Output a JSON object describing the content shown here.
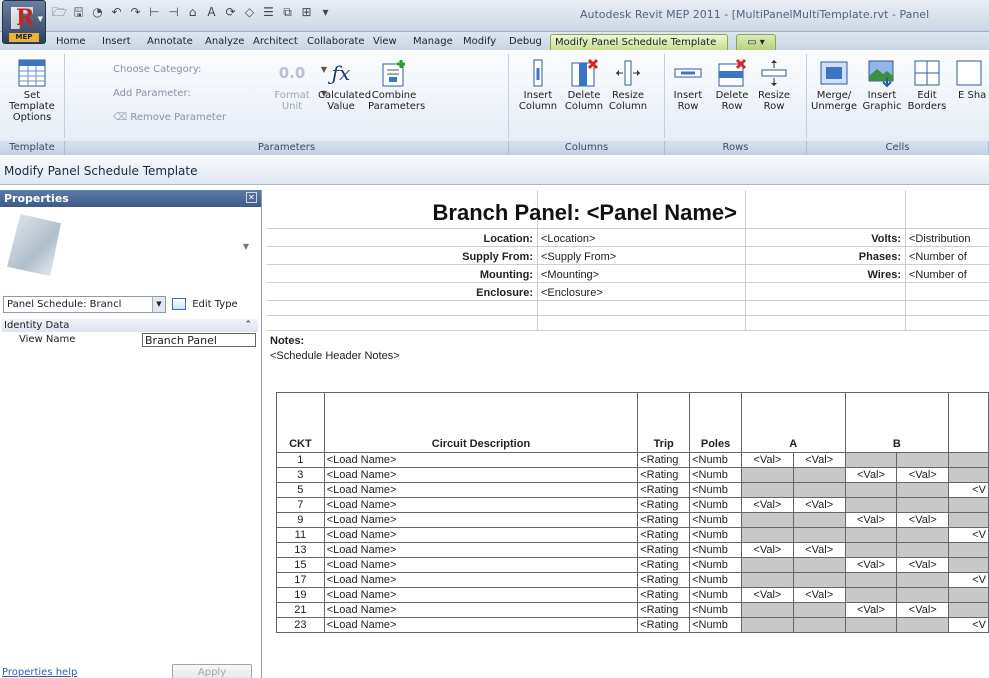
{
  "app": {
    "window_title": "Autodesk Revit MEP 2011 - [MultiPanelMultiTemplate.rvt - Panel",
    "app_button_tag": "MEP"
  },
  "tabs": [
    {
      "label": "Home"
    },
    {
      "label": "Insert"
    },
    {
      "label": "Annotate"
    },
    {
      "label": "Analyze"
    },
    {
      "label": "Architect"
    },
    {
      "label": "Collaborate"
    },
    {
      "label": "View"
    },
    {
      "label": "Manage"
    },
    {
      "label": "Modify"
    },
    {
      "label": "Debug"
    },
    {
      "label": "Modify Panel Schedule Template"
    }
  ],
  "ribbon": {
    "set_template_options": "Set Template Options",
    "choose_category": "Choose Category:",
    "add_parameter": "Add Parameter:",
    "remove_parameter": "Remove Parameter",
    "format_unit": "Format Unit",
    "calculated_value": "Calculated Value",
    "combine_parameters": "Combine Parameters",
    "insert_column": "Insert Column",
    "delete_column": "Delete Column",
    "resize_column": "Resize Column",
    "insert_row": "Insert Row",
    "delete_row": "Delete Row",
    "resize_row": "Resize Row",
    "merge_unmerge": "Merge/ Unmerge",
    "insert_graphic": "Insert Graphic",
    "edit_borders": "Edit Borders",
    "edit_shading": "E Sha",
    "panels": {
      "template": "Template",
      "parameters": "Parameters",
      "columns": "Columns",
      "rows": "Rows",
      "cells": "Cells"
    }
  },
  "options_bar": {
    "title": "Modify Panel Schedule Template"
  },
  "properties": {
    "header": "Properties",
    "type_selector": "Panel Schedule: Brancl",
    "edit_type": "Edit Type",
    "group": "Identity Data",
    "view_name_label": "View Name",
    "view_name_value": "Branch Panel",
    "help": "Properties help",
    "apply": "Apply"
  },
  "schedule": {
    "title": "Branch Panel: <Panel Name>",
    "info_left": [
      {
        "label": "Location:",
        "value": "<Location>"
      },
      {
        "label": "Supply From:",
        "value": "<Supply From>"
      },
      {
        "label": "Mounting:",
        "value": "<Mounting>"
      },
      {
        "label": "Enclosure:",
        "value": "<Enclosure>"
      }
    ],
    "info_right": [
      {
        "label": "Volts:",
        "value": "<Distribution"
      },
      {
        "label": "Phases:",
        "value": "<Number of"
      },
      {
        "label": "Wires:",
        "value": "<Number of"
      }
    ],
    "notes_label": "Notes:",
    "notes_value": "<Schedule Header Notes>",
    "columns": {
      "ckt": "CKT",
      "description": "Circuit Description",
      "trip": "Trip",
      "poles": "Poles",
      "a": "A",
      "b": "B"
    },
    "rows": [
      {
        "ckt": "1",
        "desc": "<Load Name>",
        "trip": "<Rating",
        "poles": "<Numb",
        "phase": "A"
      },
      {
        "ckt": "3",
        "desc": "<Load Name>",
        "trip": "<Rating",
        "poles": "<Numb",
        "phase": "B"
      },
      {
        "ckt": "5",
        "desc": "<Load Name>",
        "trip": "<Rating",
        "poles": "<Numb",
        "phase": "C"
      },
      {
        "ckt": "7",
        "desc": "<Load Name>",
        "trip": "<Rating",
        "poles": "<Numb",
        "phase": "A"
      },
      {
        "ckt": "9",
        "desc": "<Load Name>",
        "trip": "<Rating",
        "poles": "<Numb",
        "phase": "B"
      },
      {
        "ckt": "11",
        "desc": "<Load Name>",
        "trip": "<Rating",
        "poles": "<Numb",
        "phase": "C"
      },
      {
        "ckt": "13",
        "desc": "<Load Name>",
        "trip": "<Rating",
        "poles": "<Numb",
        "phase": "A"
      },
      {
        "ckt": "15",
        "desc": "<Load Name>",
        "trip": "<Rating",
        "poles": "<Numb",
        "phase": "B"
      },
      {
        "ckt": "17",
        "desc": "<Load Name>",
        "trip": "<Rating",
        "poles": "<Numb",
        "phase": "C"
      },
      {
        "ckt": "19",
        "desc": "<Load Name>",
        "trip": "<Rating",
        "poles": "<Numb",
        "phase": "A"
      },
      {
        "ckt": "21",
        "desc": "<Load Name>",
        "trip": "<Rating",
        "poles": "<Numb",
        "phase": "B"
      },
      {
        "ckt": "23",
        "desc": "<Load Name>",
        "trip": "<Rating",
        "poles": "<Numb",
        "phase": "C"
      }
    ],
    "val_text": "<Val>",
    "val_text_clipped": "<V"
  }
}
